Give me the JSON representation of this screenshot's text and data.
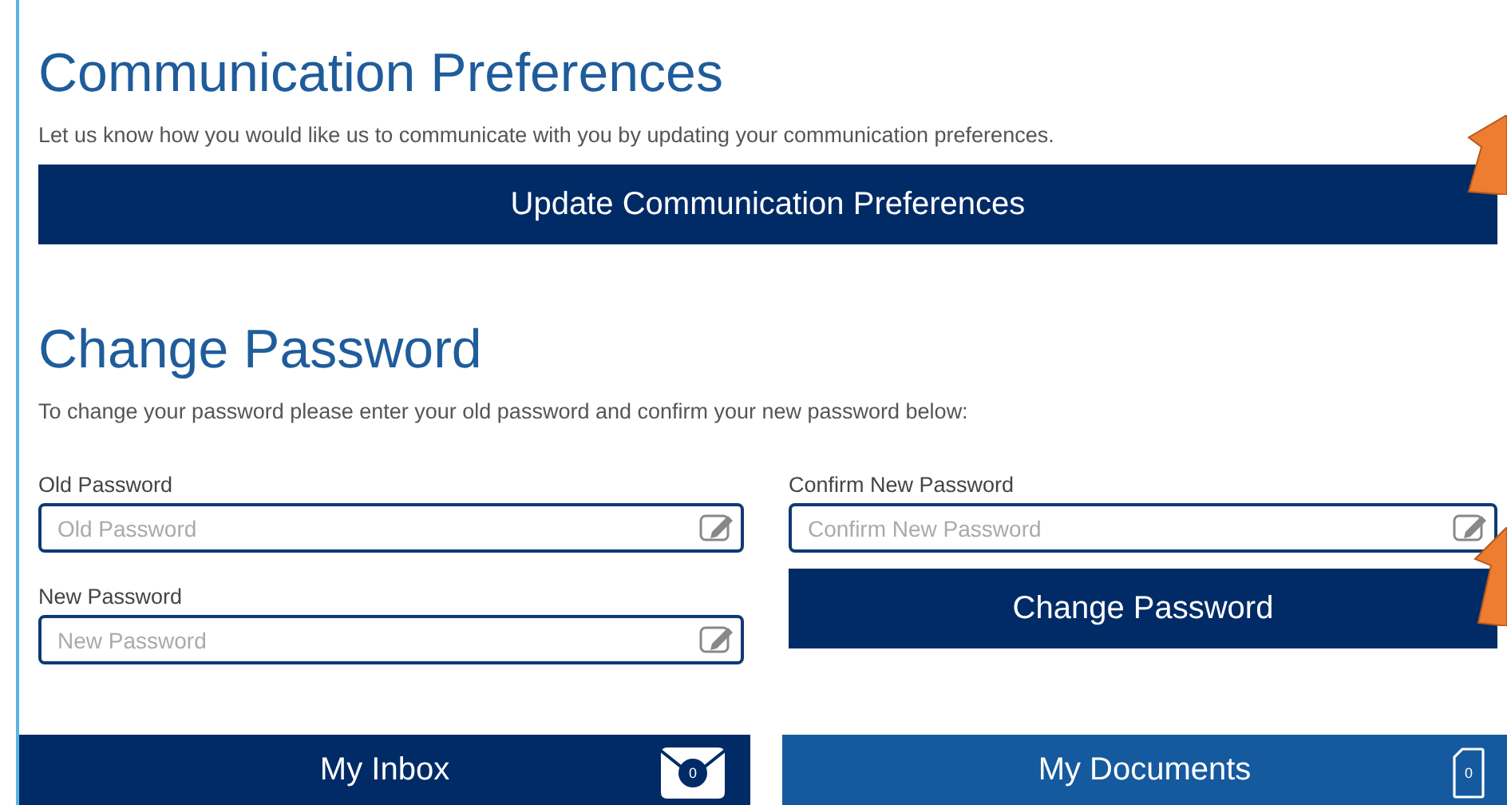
{
  "communication": {
    "title": "Communication Preferences",
    "description": "Let us know how you would like us to communicate with you by updating your communication preferences.",
    "button": "Update Communication Preferences"
  },
  "password": {
    "title": "Change Password",
    "description": "To change your password please enter your old password and confirm your new password below:",
    "fields": [
      {
        "label": "Old Password",
        "placeholder": "Old Password"
      },
      {
        "label": "New Password",
        "placeholder": "New Password"
      },
      {
        "label": "Confirm New Password",
        "placeholder": "Confirm New Password"
      }
    ],
    "button": "Change Password"
  },
  "tiles": [
    {
      "kind": "inbox",
      "label": "My Inbox",
      "count": "0"
    },
    {
      "kind": "documents",
      "label": "My Documents",
      "count": "0"
    }
  ]
}
